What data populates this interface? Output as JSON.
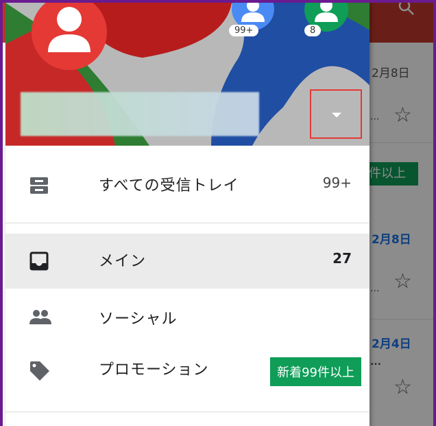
{
  "drawer": {
    "header": {
      "account_badges": [
        "99+",
        "8"
      ]
    },
    "items": [
      {
        "label": "すべての受信トレイ",
        "count": "99+",
        "icon": "all-inboxes-icon"
      },
      {
        "label": "メイン",
        "count": "27",
        "icon": "inbox-icon"
      },
      {
        "label": "ソーシャル",
        "count": "",
        "icon": "people-icon"
      },
      {
        "label": "プロモーション",
        "badge": "新着99件以上",
        "icon": "tag-icon"
      }
    ]
  },
  "background_list": {
    "dates": [
      "2月8日",
      "2月8日",
      "2月4日"
    ],
    "badge": "件以上",
    "dots": [
      "...",
      "...",
      "..."
    ]
  },
  "colors": {
    "accent_red": "#e53935",
    "badge_green": "#0f9d58",
    "active_row": "#ebebeb",
    "date_blue": "#1a73e8"
  }
}
